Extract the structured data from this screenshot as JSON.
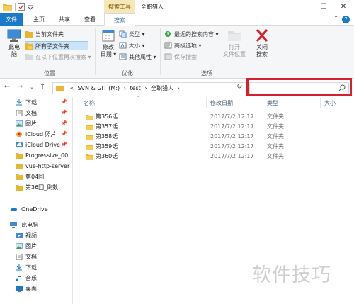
{
  "window": {
    "title": "全职猎人",
    "context_tab": "搜索工具",
    "controls": {
      "minimize": "─",
      "maximize": "☐",
      "close": "✕"
    }
  },
  "tabs": [
    {
      "label": "文件"
    },
    {
      "label": "主页"
    },
    {
      "label": "共享"
    },
    {
      "label": "查看"
    },
    {
      "label": "搜索"
    }
  ],
  "ribbon": {
    "location": {
      "label": "位置",
      "this_pc": "此电\n脑",
      "current_folder": "当前文件夹",
      "all_subfolders": "所有子文件夹",
      "search_again": "在以下位置再次搜索"
    },
    "refine": {
      "label": "优化",
      "modified_date": "修改\n日期",
      "kind": "类型",
      "size": "大小",
      "other_props": "其他属性"
    },
    "options": {
      "label": "选项",
      "recent": "最近的搜索内容",
      "advanced": "高级选项",
      "save_search": "保存搜索",
      "open_location": "打开\n文件位置"
    },
    "close": {
      "label": "关闭\n搜索"
    }
  },
  "address": {
    "path_prefix": "«",
    "segments": [
      "SVN & GIT (M:)",
      "test",
      "全职猎人"
    ],
    "separator": "›",
    "search_placeholder": ""
  },
  "nav": {
    "quick": [
      {
        "label": "下载",
        "icon": "download-icon",
        "pinned": true
      },
      {
        "label": "文档",
        "icon": "document-icon",
        "pinned": true
      },
      {
        "label": "图片",
        "icon": "picture-icon",
        "pinned": true
      },
      {
        "label": "iCloud 照片",
        "icon": "icloud-photos-icon",
        "pinned": true
      },
      {
        "label": "iCloud Drive",
        "icon": "icloud-drive-icon",
        "pinned": true
      },
      {
        "label": "Progressive_00",
        "icon": "folder-icon",
        "pinned": false
      },
      {
        "label": "vue-http-server",
        "icon": "folder-icon",
        "pinned": false
      },
      {
        "label": "第04回",
        "icon": "folder-icon",
        "pinned": false
      },
      {
        "label": "第36回_倒数",
        "icon": "folder-icon",
        "pinned": false
      }
    ],
    "onedrive": "OneDrive",
    "this_pc": {
      "label": "此电脑",
      "items": [
        {
          "label": "视频",
          "icon": "video-icon"
        },
        {
          "label": "图片",
          "icon": "picture-icon"
        },
        {
          "label": "文档",
          "icon": "document-icon"
        },
        {
          "label": "下载",
          "icon": "download-icon"
        },
        {
          "label": "音乐",
          "icon": "music-icon"
        },
        {
          "label": "桌面",
          "icon": "desktop-icon"
        }
      ]
    }
  },
  "columns": [
    "名称",
    "修改日期",
    "类型",
    "大小"
  ],
  "files": [
    {
      "name": "第356话",
      "date": "2017/7/2 12:17",
      "type": "文件夹",
      "size": ""
    },
    {
      "name": "第357话",
      "date": "2017/7/2 12:17",
      "type": "文件夹",
      "size": ""
    },
    {
      "name": "第358话",
      "date": "2017/7/2 12:17",
      "type": "文件夹",
      "size": ""
    },
    {
      "name": "第359话",
      "date": "2017/7/2 12:17",
      "type": "文件夹",
      "size": ""
    },
    {
      "name": "第360话",
      "date": "2017/7/2 12:17",
      "type": "文件夹",
      "size": ""
    }
  ],
  "watermark": "软件技巧",
  "colors": {
    "accent": "#1979ca",
    "context_tab": "#f6e7b8",
    "highlight": "#d6202d",
    "folder": "#e8b730"
  }
}
